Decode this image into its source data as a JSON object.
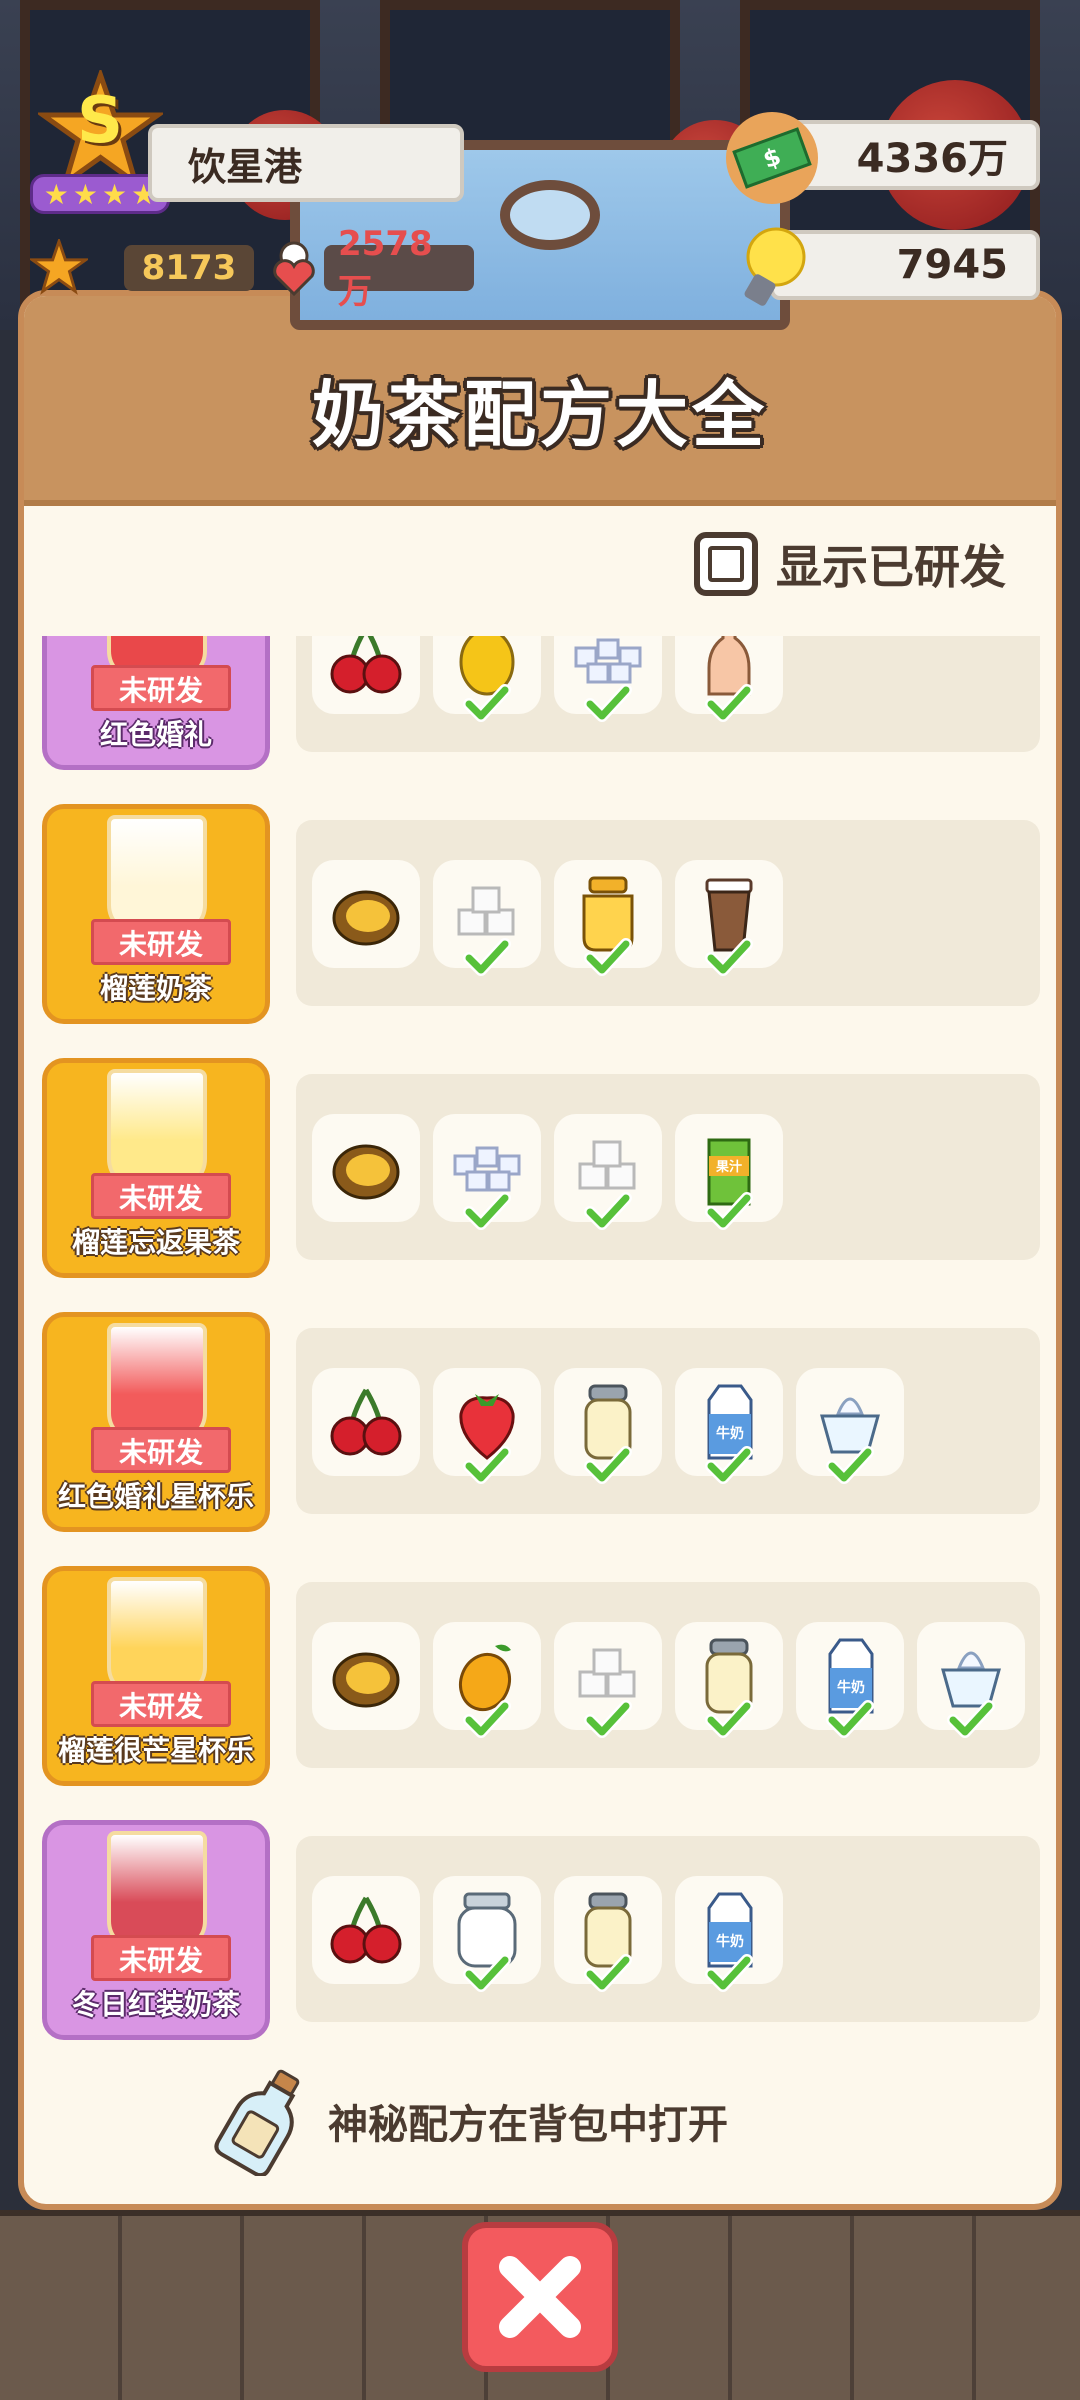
{
  "player": {
    "shop_name": "饮星港",
    "rank_letter": "S",
    "stars": "8173",
    "fans": "2578万"
  },
  "currency": {
    "money": "4336万",
    "ideas": "7945"
  },
  "panel": {
    "title": "奶茶配方大全",
    "filter_label": "显示已研发",
    "footer_tip": "神秘配方在背包中打开"
  },
  "status_label": "未研发",
  "recipes": [
    {
      "name": "红色婚礼",
      "theme": "purple",
      "cup": "#e9484a",
      "ingredients": [
        {
          "icon": "cherry",
          "checked": false
        },
        {
          "icon": "lemon",
          "checked": true
        },
        {
          "icon": "ice",
          "checked": true
        },
        {
          "icon": "syrup-bottle",
          "checked": true
        }
      ]
    },
    {
      "name": "榴莲奶茶",
      "theme": "gold",
      "cup": "#fff6d8",
      "ingredients": [
        {
          "icon": "durian",
          "checked": false
        },
        {
          "icon": "sugar-cube",
          "checked": true
        },
        {
          "icon": "honey-jar",
          "checked": true
        },
        {
          "icon": "coffee-cup",
          "checked": true
        }
      ]
    },
    {
      "name": "榴莲忘返果茶",
      "theme": "gold",
      "cup": "#ffe98a",
      "ingredients": [
        {
          "icon": "durian",
          "checked": false
        },
        {
          "icon": "ice",
          "checked": true
        },
        {
          "icon": "sugar-cube",
          "checked": true
        },
        {
          "icon": "juice-box",
          "checked": true
        }
      ]
    },
    {
      "name": "红色婚礼星杯乐",
      "theme": "gold",
      "cup": "#f25b5b",
      "ingredients": [
        {
          "icon": "cherry",
          "checked": false
        },
        {
          "icon": "strawberry",
          "checked": true
        },
        {
          "icon": "cream-jar",
          "checked": true
        },
        {
          "icon": "milk-carton",
          "checked": true
        },
        {
          "icon": "ice-cream",
          "checked": true
        }
      ]
    },
    {
      "name": "榴莲很芒星杯乐",
      "theme": "gold",
      "cup": "#ffd45a",
      "ingredients": [
        {
          "icon": "durian",
          "checked": false
        },
        {
          "icon": "mango",
          "checked": true
        },
        {
          "icon": "sugar-cube",
          "checked": true
        },
        {
          "icon": "cream-jar",
          "checked": true
        },
        {
          "icon": "milk-carton",
          "checked": true
        },
        {
          "icon": "ice-cream",
          "checked": true
        }
      ]
    },
    {
      "name": "冬日红装奶茶",
      "theme": "purple",
      "cup": "#d94b58",
      "ingredients": [
        {
          "icon": "cherry",
          "checked": false
        },
        {
          "icon": "glass-jar",
          "checked": true
        },
        {
          "icon": "cream-jar",
          "checked": true
        },
        {
          "icon": "milk-carton",
          "checked": true
        }
      ]
    }
  ],
  "milk_label": "牛奶",
  "juice_label": "果汁",
  "colors": {
    "panel_header": "#c8935f",
    "card_gold": "#f7b51f",
    "card_purple": "#d995e3",
    "ribbon": "#f2696c",
    "check": "#57c13a",
    "close_button": "#f35a5e"
  }
}
